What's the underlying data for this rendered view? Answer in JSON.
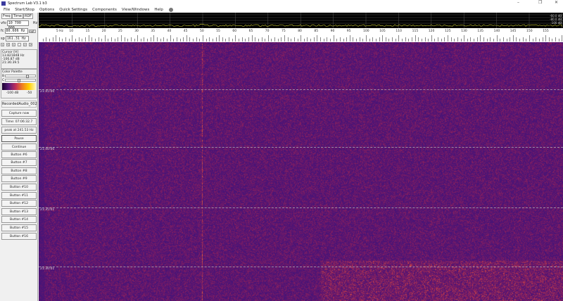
{
  "window": {
    "title": "Spectrum Lab V3.1 b3",
    "minimize": "–",
    "restore": "❐",
    "close": "✕"
  },
  "menu": [
    "File",
    "Start/Stop",
    "Options",
    "Quick Settings",
    "Components",
    "View/Windows",
    "Help"
  ],
  "left": {
    "tabs": [
      "Freq",
      "Time",
      "RDF"
    ],
    "vfo_label": "vfo",
    "vfo_value": "10 700 000",
    "vfo_unit": "Hz",
    "fc_label": "fc",
    "fc_value": "80.606 Hz",
    "opt_label": "opt",
    "sp_label": "sp",
    "sp_value": "161.31 Hz",
    "arrows": [
      "«",
      "<",
      "«",
      ".",
      "»",
      ">"
    ],
    "cursor": {
      "title": "Cursor [H]",
      "freq": "13.821848 Hz",
      "level": "-106.87 dB",
      "time": "21:36:39.5"
    },
    "palette": {
      "title": "Color Palette",
      "b_label": "B",
      "c_label": "C",
      "b_level": 0.75,
      "c_level": 0.45,
      "min_label": "-100 dB",
      "max_label": "-50"
    },
    "recording": "RecordedAudio_002",
    "capture": "Capture now",
    "time": "Time:  07:06:32.7",
    "peak": "peak at 241.53 Hz",
    "buttons": [
      "Pause",
      "Continue",
      "Button #6",
      "Button #7",
      "Button #8",
      "Button #9",
      "Button #10",
      "Button #11",
      "Button #12",
      "Button #13",
      "Button #14",
      "Button #15",
      "Button #16"
    ]
  },
  "spectrum": {
    "db_labels": [
      "-60.0 dB",
      "-80.0 dB",
      "-100 dB"
    ],
    "trace_color": "#c8c832"
  },
  "scale": {
    "first_label": "5 Hz",
    "labels": [
      "10",
      "15",
      "20",
      "25",
      "30",
      "35",
      "40",
      "45",
      "50",
      "55",
      "60",
      "65",
      "70",
      "75",
      "80",
      "85",
      "90",
      "95",
      "100",
      "105",
      "110",
      "115",
      "120",
      "125",
      "130",
      "135",
      "140",
      "145",
      "150",
      "155"
    ]
  },
  "waterfall": {
    "time_labels": [
      "21:45:00",
      "21:40:00",
      "21:35:01",
      "21:30:01"
    ],
    "colors": {
      "base": "#4a1a78",
      "warm": "#e07a30"
    }
  }
}
